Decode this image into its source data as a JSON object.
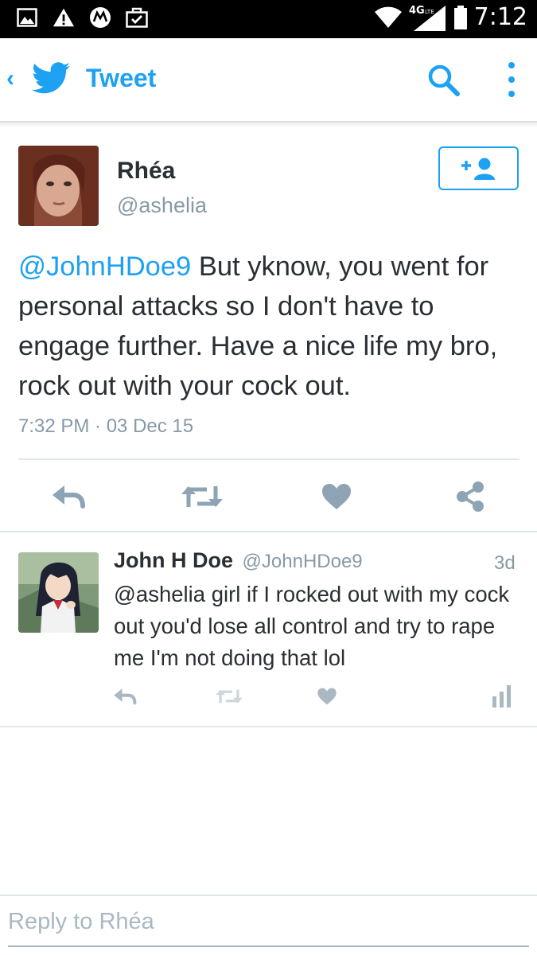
{
  "status_bar": {
    "network": "4G LTE",
    "time": "7:12",
    "icons": [
      "image-icon",
      "alert-icon",
      "motorola-icon",
      "briefcase-icon",
      "wifi-icon",
      "signal-icon",
      "battery-icon"
    ]
  },
  "app_bar": {
    "title": "Tweet",
    "accent": "#1da1f2"
  },
  "tweet": {
    "author_name": "Rhéa",
    "author_handle": "@ashelia",
    "mention": "@JohnHDoe9",
    "body": " But yknow, you went for personal attacks so I don't have to engage further. Have a nice life my bro, rock out with your cock out.",
    "timestamp": "7:32 PM · 03 Dec 15",
    "actions": [
      "reply-icon",
      "retweet-icon",
      "like-icon",
      "share-icon"
    ]
  },
  "reply": {
    "author_name": "John H Doe",
    "author_handle": "@JohnHDoe9",
    "age": "3d",
    "body": "@ashelia girl if I rocked out with my cock out you'd lose all control and try to rape me I'm not doing that lol",
    "actions": [
      "reply-icon",
      "retweet-icon",
      "like-icon",
      "analytics-icon"
    ]
  },
  "compose": {
    "placeholder": "Reply to Rhéa",
    "value": ""
  },
  "colors": {
    "text": "#292f33",
    "secondary": "#8899a6",
    "icon_gray": "#8ea3b4",
    "divider": "#e1e8ed"
  }
}
